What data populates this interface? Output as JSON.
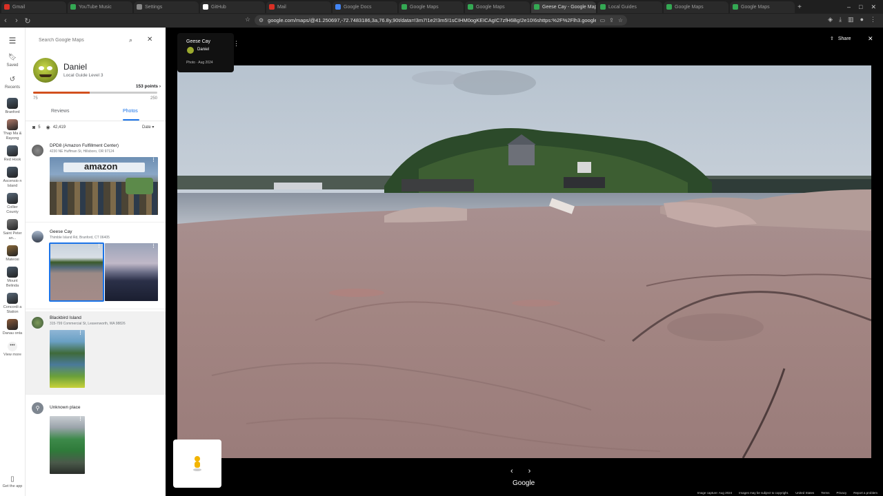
{
  "browser": {
    "tabs": [
      {
        "label": "Gmail",
        "color": "#d93025"
      },
      {
        "label": "YouTube Music",
        "color": "#34a853"
      },
      {
        "label": "Settings",
        "color": "#888888"
      },
      {
        "label": "GitHub",
        "color": "#ffffff"
      },
      {
        "label": "Mail",
        "color": "#d93025"
      },
      {
        "label": "Google Docs",
        "color": "#4285f4"
      },
      {
        "label": "Google Maps",
        "color": "#34a853"
      },
      {
        "label": "Google Maps",
        "color": "#34a853"
      },
      {
        "label": "Geese Cay - Google Maps",
        "color": "#34a853",
        "active": true
      },
      {
        "label": "Local Guides",
        "color": "#34a853"
      },
      {
        "label": "Google Maps",
        "color": "#34a853"
      },
      {
        "label": "Google Maps",
        "color": "#34a853"
      }
    ],
    "url": "google.com/maps/@41.250697,-72.7483186,3a,76.8y,90t/data=!3m7!1e2!3m5!1sCIHM0ogKEICAgIC7zfH6Bg!2e10!6shttps:%2F%2Flh3.googleus..."
  },
  "rail": {
    "saved": "Saved",
    "recents": "Recents",
    "places": [
      {
        "label": "Branford",
        "color": "#4a5b6b"
      },
      {
        "label": "Thap Ma & Rayong",
        "color": "#b07a6a"
      },
      {
        "label": "Red Hook",
        "color": "#5a6a7a"
      },
      {
        "label": "Ascensio n Island",
        "color": "#4a5a6a"
      },
      {
        "label": "Collier County",
        "color": "#5a6a7a"
      },
      {
        "label": "Saint Peter an...",
        "color": "#7a7a7a"
      },
      {
        "label": "Mateosi",
        "color": "#8a6a3a"
      },
      {
        "label": "Mount Belinda",
        "color": "#4a5a6a"
      },
      {
        "label": "Concordi a Station",
        "color": "#5a6a7a"
      },
      {
        "label": "Danau onta",
        "color": "#8a5a3a"
      }
    ],
    "view_more": "View more",
    "get_app": "Get the app"
  },
  "panel": {
    "search_placeholder": "Search Google Maps",
    "profile": {
      "name": "Daniel",
      "level": "Local Guide Level 3",
      "points": "153 points ›",
      "progress_min": "75",
      "progress_max": "250",
      "progress_fraction": 0.456
    },
    "tabs": {
      "reviews": "Reviews",
      "photos": "Photos"
    },
    "stats": {
      "photos": "5",
      "views": "42,419",
      "sort": "Date ▾"
    },
    "entries": [
      {
        "title": "DPD8 (Amazon Fulfillment Center)",
        "address": "4230 NE Huffman St, Hillsboro, OR 97124",
        "photo_text": "amazon"
      },
      {
        "title": "Geese Cay",
        "address": "Thimble Island Rd, Branford, CT 06405"
      },
      {
        "title": "Blackbird Island",
        "address": "315-799 Commercial St, Leavenworth, WA 98826"
      },
      {
        "title": "Unknown place",
        "address": ""
      }
    ]
  },
  "viewer": {
    "title": "Geese Cay",
    "user": "Daniel",
    "date": "Photo · Aug 2024",
    "share": "Share",
    "logo": "Google",
    "footer": [
      "Image capture: Aug 2024",
      "Images may be subject to copyright.",
      "United States",
      "Terms",
      "Privacy",
      "Report a problem"
    ]
  }
}
